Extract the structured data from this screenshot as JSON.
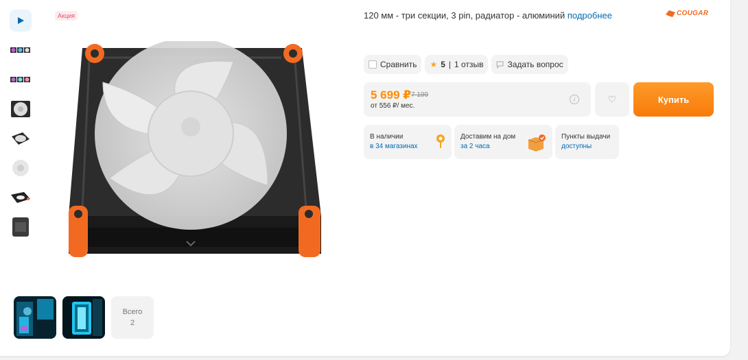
{
  "badge": "Акция",
  "description": {
    "text": "120 мм - три секции, 3 pin, радиатор - алюминий",
    "link": "подробнее"
  },
  "brand": "COUGAR",
  "actions": {
    "compare": "Сравнить",
    "rating": "5",
    "reviews": "1 отзыв",
    "ask": "Задать вопрос"
  },
  "price": {
    "current": "5 699 ₽",
    "old": "7 199",
    "monthly": "от 556 ₽/ мес."
  },
  "buy_label": "Купить",
  "availability": {
    "stock_title": "В наличии",
    "stock_link": "в 34 магазинах",
    "delivery_title": "Доставим на дом",
    "delivery_link": "за 2 часа",
    "pickup_title": "Пункты выдачи",
    "pickup_link": "доступны"
  },
  "gallery": {
    "total_label": "Всего",
    "total_count": "2"
  },
  "colors": {
    "accent": "#ff8c00",
    "link": "#0069b4",
    "buy": "#f87a0a",
    "fan_orange": "#f26a21"
  }
}
